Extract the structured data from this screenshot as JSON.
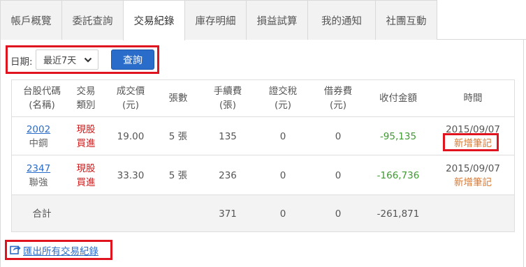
{
  "tabs": [
    {
      "label": "帳戶概覽",
      "active": false
    },
    {
      "label": "委託查詢",
      "active": false
    },
    {
      "label": "交易紀錄",
      "active": true
    },
    {
      "label": "庫存明細",
      "active": false
    },
    {
      "label": "損益試算",
      "active": false
    },
    {
      "label": "我的通知",
      "active": false
    },
    {
      "label": "社團互動",
      "active": false
    }
  ],
  "filter": {
    "date_label": "日期:",
    "date_value": "最近7天",
    "query_label": "查詢"
  },
  "table": {
    "headers": [
      [
        "台股代碼",
        "(名稱)"
      ],
      [
        "交易",
        "類別"
      ],
      [
        "成交價",
        "(元)"
      ],
      [
        "張數"
      ],
      [
        "手續費",
        "(張)"
      ],
      [
        "證交稅",
        "(元)"
      ],
      [
        "借券費",
        "(元)"
      ],
      [
        "收付金額"
      ],
      [
        "時間"
      ]
    ],
    "rows": [
      {
        "code": "2002",
        "name": "中鋼",
        "type_line1": "現股",
        "type_line2": "買進",
        "price": "19.00",
        "lots": "5 張",
        "fee": "135",
        "tax": "0",
        "borrow": "0",
        "amount": "-95,135",
        "date": "2015/09/07",
        "note": "新增筆記"
      },
      {
        "code": "2347",
        "name": "聯強",
        "type_line1": "現股",
        "type_line2": "買進",
        "price": "33.30",
        "lots": "5 張",
        "fee": "236",
        "tax": "0",
        "borrow": "0",
        "amount": "-166,736",
        "date": "2015/09/07",
        "note": "新增筆記"
      }
    ],
    "total": {
      "label": "合計",
      "fee": "371",
      "tax": "0",
      "borrow": "0",
      "amount": "-261,871"
    }
  },
  "export_label": "匯出所有交易紀錄",
  "colors": {
    "accent_blue": "#2a6cc9",
    "highlight_red": "#e0141e",
    "buy_red": "#d11a1a",
    "amount_green": "#3d9a2f",
    "note_orange": "#d9772f"
  }
}
